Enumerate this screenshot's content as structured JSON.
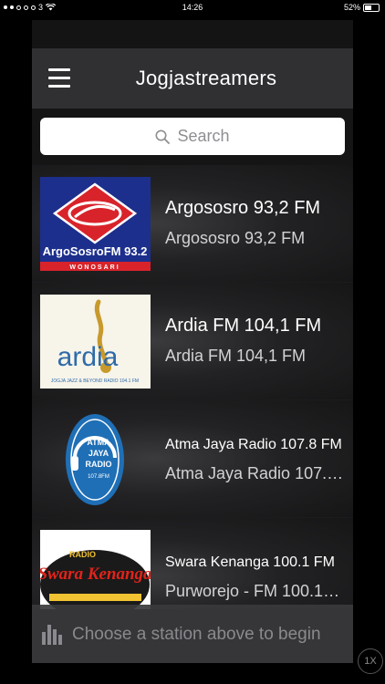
{
  "status_bar": {
    "carrier": "3",
    "time": "14:26",
    "battery": "52%",
    "battery_level": 0.52
  },
  "navbar": {
    "title": "Jogjastreamers",
    "menu_icon": "hamburger-menu-icon"
  },
  "search": {
    "placeholder": "Search",
    "icon": "search-icon"
  },
  "stations": [
    {
      "title": "Argososro 93,2 FM",
      "subtitle": "Argososro 93,2 FM",
      "logo_text": "ArgoSosroFM 93.2",
      "logo_caption": "WONOSARI"
    },
    {
      "title": "Ardia FM 104,1 FM",
      "subtitle": "Ardia FM 104,1 FM",
      "logo_text": "ardia",
      "logo_caption": "JOGJA JAZZ & BEYOND RADIO  104.1 FM"
    },
    {
      "title": "Atma Jaya Radio 107.8 FM",
      "subtitle": "Atma Jaya Radio 107.…",
      "logo_text": "ATMA JAYA RADIO",
      "logo_caption": "107.8FM"
    },
    {
      "title": "Swara Kenanga 100.1 FM",
      "subtitle": "Purworejo - FM 100.1…",
      "logo_text": "Swara Kenanga",
      "logo_caption": "RADIO"
    }
  ],
  "player": {
    "message": "Choose a station above to begin",
    "icon": "equalizer-bars-icon"
  },
  "speed_button": {
    "label": "1X"
  },
  "colors": {
    "navbar": "#303033",
    "background": "#151516",
    "player_bar": "#3a3a3c"
  }
}
